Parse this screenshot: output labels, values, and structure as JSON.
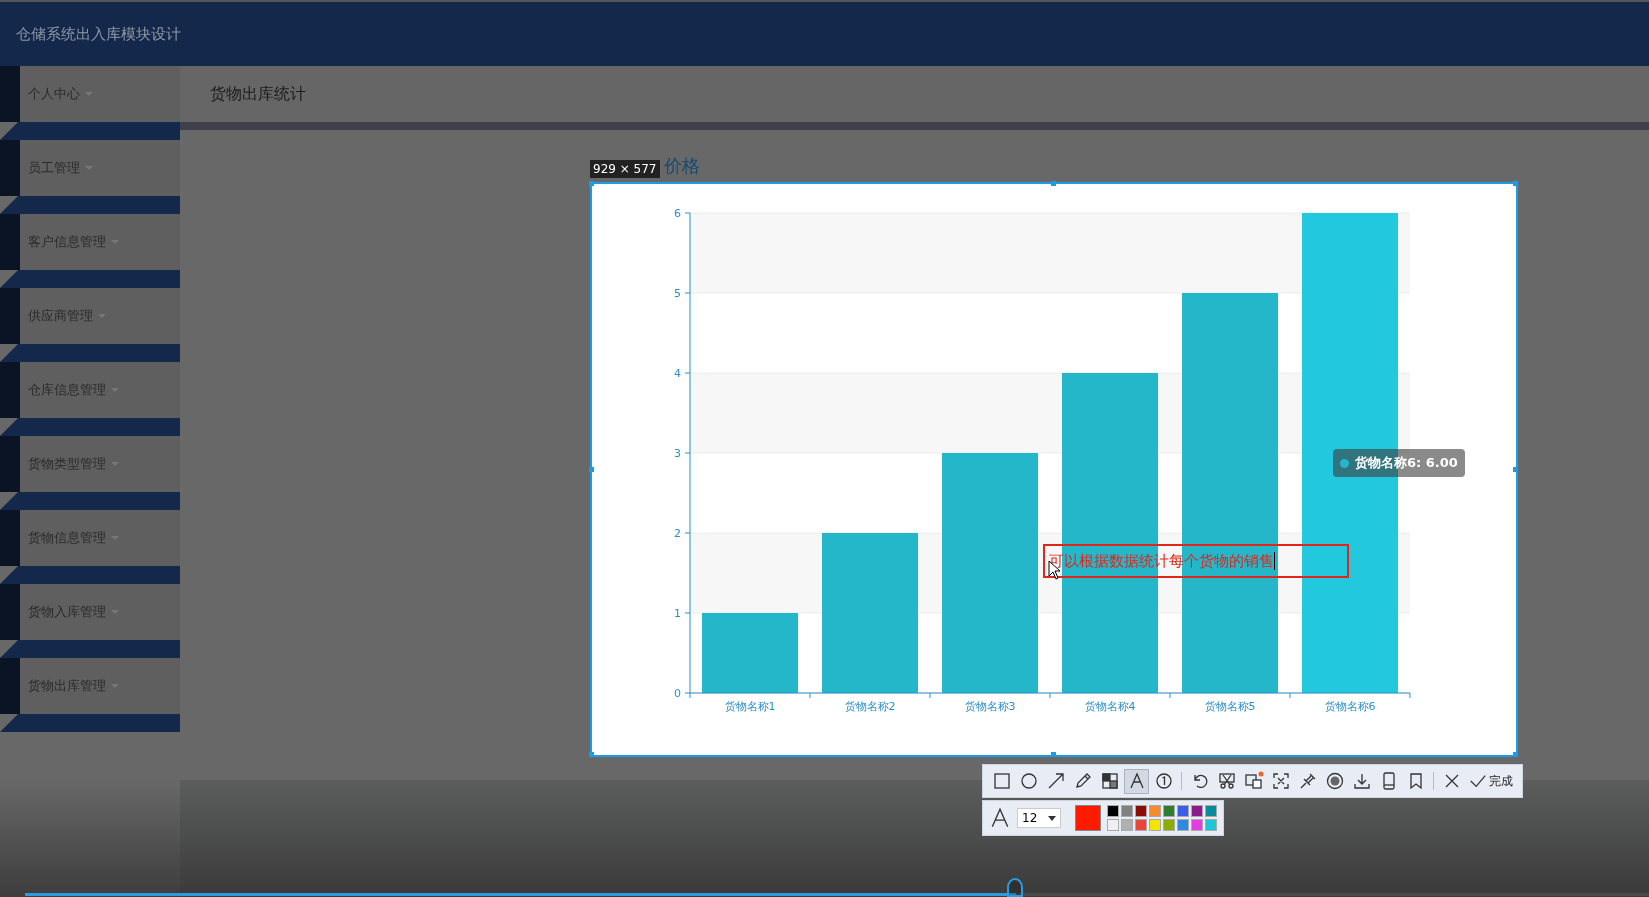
{
  "header": {
    "title": "仓储系统出入库模块设计"
  },
  "sidebar": {
    "items": [
      {
        "label": "个人中心"
      },
      {
        "label": "员工管理"
      },
      {
        "label": "客户信息管理"
      },
      {
        "label": "供应商管理"
      },
      {
        "label": "仓库信息管理"
      },
      {
        "label": "货物类型管理"
      },
      {
        "label": "货物信息管理"
      },
      {
        "label": "货物入库管理"
      },
      {
        "label": "货物出库管理"
      }
    ]
  },
  "page": {
    "title": "货物出库统计"
  },
  "capture": {
    "size_label": "929 × 577",
    "chart_title": "价格",
    "chart_data": {
      "type": "bar",
      "categories": [
        "货物名称1",
        "货物名称2",
        "货物名称3",
        "货物名称4",
        "货物名称5",
        "货物名称6"
      ],
      "values": [
        1,
        2,
        3,
        4,
        5,
        6
      ],
      "ylim": [
        0,
        6
      ],
      "yticks": [
        0,
        1,
        2,
        3,
        4,
        5,
        6
      ],
      "grid": true
    },
    "tooltip": {
      "text": "货物名称6: 6.00"
    },
    "annotation": {
      "text": "可以根据数据统计每个货物的销售"
    }
  },
  "toolbar": {
    "tools": [
      {
        "kind": "rect",
        "selected": false
      },
      {
        "kind": "ellipse",
        "selected": false
      },
      {
        "kind": "arrow",
        "selected": false
      },
      {
        "kind": "pencil",
        "selected": false
      },
      {
        "kind": "mosaic",
        "selected": false
      },
      {
        "kind": "text",
        "selected": true
      },
      {
        "kind": "number",
        "selected": false
      },
      {
        "kind": "undo",
        "selected": false
      },
      {
        "kind": "cut",
        "selected": false
      },
      {
        "kind": "translate",
        "selected": false
      },
      {
        "kind": "ocr",
        "selected": false
      },
      {
        "kind": "pin",
        "selected": false
      },
      {
        "kind": "record",
        "selected": false
      },
      {
        "kind": "download",
        "selected": false
      },
      {
        "kind": "phone",
        "selected": false
      },
      {
        "kind": "bookmark",
        "selected": false
      },
      {
        "kind": "close",
        "selected": false
      },
      {
        "kind": "done",
        "label": "完成",
        "selected": false
      }
    ],
    "font_size": "12",
    "current": {
      "color": "#ff1a00"
    },
    "palette": [
      {
        "color": "#000000",
        "selected": false
      },
      {
        "color": "#808080",
        "selected": false
      },
      {
        "color": "#8b0a0a",
        "selected": false
      },
      {
        "color": "#f58a2f",
        "selected": false
      },
      {
        "color": "#2e7d32",
        "selected": false
      },
      {
        "color": "#3b5ee6",
        "selected": false
      },
      {
        "color": "#8b1a8b",
        "selected": false
      },
      {
        "color": "#0b8a9a",
        "selected": false
      },
      {
        "color": "#f0f0f0",
        "selected": false
      },
      {
        "color": "#b0b0b0",
        "selected": false
      },
      {
        "color": "#e8453c",
        "selected": false
      },
      {
        "color": "#f2e600",
        "selected": false
      },
      {
        "color": "#8aad00",
        "selected": false
      },
      {
        "color": "#2d8ae0",
        "selected": false
      },
      {
        "color": "#e63ce6",
        "selected": false
      },
      {
        "color": "#1bc6d6",
        "selected": false
      }
    ]
  },
  "player": {
    "level": 0.61
  }
}
